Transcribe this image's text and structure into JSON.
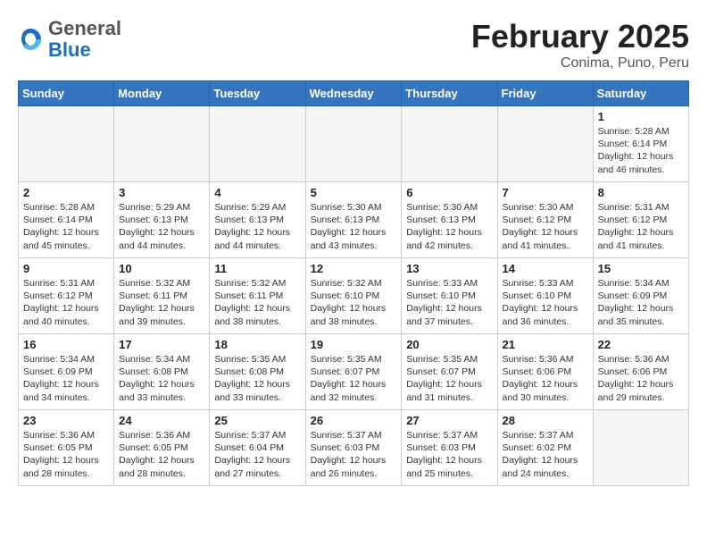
{
  "header": {
    "logo_general": "General",
    "logo_blue": "Blue",
    "title": "February 2025",
    "subtitle": "Conima, Puno, Peru"
  },
  "days_of_week": [
    "Sunday",
    "Monday",
    "Tuesday",
    "Wednesday",
    "Thursday",
    "Friday",
    "Saturday"
  ],
  "weeks": [
    [
      {
        "day": "",
        "info": ""
      },
      {
        "day": "",
        "info": ""
      },
      {
        "day": "",
        "info": ""
      },
      {
        "day": "",
        "info": ""
      },
      {
        "day": "",
        "info": ""
      },
      {
        "day": "",
        "info": ""
      },
      {
        "day": "1",
        "info": "Sunrise: 5:28 AM\nSunset: 6:14 PM\nDaylight: 12 hours\nand 46 minutes."
      }
    ],
    [
      {
        "day": "2",
        "info": "Sunrise: 5:28 AM\nSunset: 6:14 PM\nDaylight: 12 hours\nand 45 minutes."
      },
      {
        "day": "3",
        "info": "Sunrise: 5:29 AM\nSunset: 6:13 PM\nDaylight: 12 hours\nand 44 minutes."
      },
      {
        "day": "4",
        "info": "Sunrise: 5:29 AM\nSunset: 6:13 PM\nDaylight: 12 hours\nand 44 minutes."
      },
      {
        "day": "5",
        "info": "Sunrise: 5:30 AM\nSunset: 6:13 PM\nDaylight: 12 hours\nand 43 minutes."
      },
      {
        "day": "6",
        "info": "Sunrise: 5:30 AM\nSunset: 6:13 PM\nDaylight: 12 hours\nand 42 minutes."
      },
      {
        "day": "7",
        "info": "Sunrise: 5:30 AM\nSunset: 6:12 PM\nDaylight: 12 hours\nand 41 minutes."
      },
      {
        "day": "8",
        "info": "Sunrise: 5:31 AM\nSunset: 6:12 PM\nDaylight: 12 hours\nand 41 minutes."
      }
    ],
    [
      {
        "day": "9",
        "info": "Sunrise: 5:31 AM\nSunset: 6:12 PM\nDaylight: 12 hours\nand 40 minutes."
      },
      {
        "day": "10",
        "info": "Sunrise: 5:32 AM\nSunset: 6:11 PM\nDaylight: 12 hours\nand 39 minutes."
      },
      {
        "day": "11",
        "info": "Sunrise: 5:32 AM\nSunset: 6:11 PM\nDaylight: 12 hours\nand 38 minutes."
      },
      {
        "day": "12",
        "info": "Sunrise: 5:32 AM\nSunset: 6:10 PM\nDaylight: 12 hours\nand 38 minutes."
      },
      {
        "day": "13",
        "info": "Sunrise: 5:33 AM\nSunset: 6:10 PM\nDaylight: 12 hours\nand 37 minutes."
      },
      {
        "day": "14",
        "info": "Sunrise: 5:33 AM\nSunset: 6:10 PM\nDaylight: 12 hours\nand 36 minutes."
      },
      {
        "day": "15",
        "info": "Sunrise: 5:34 AM\nSunset: 6:09 PM\nDaylight: 12 hours\nand 35 minutes."
      }
    ],
    [
      {
        "day": "16",
        "info": "Sunrise: 5:34 AM\nSunset: 6:09 PM\nDaylight: 12 hours\nand 34 minutes."
      },
      {
        "day": "17",
        "info": "Sunrise: 5:34 AM\nSunset: 6:08 PM\nDaylight: 12 hours\nand 33 minutes."
      },
      {
        "day": "18",
        "info": "Sunrise: 5:35 AM\nSunset: 6:08 PM\nDaylight: 12 hours\nand 33 minutes."
      },
      {
        "day": "19",
        "info": "Sunrise: 5:35 AM\nSunset: 6:07 PM\nDaylight: 12 hours\nand 32 minutes."
      },
      {
        "day": "20",
        "info": "Sunrise: 5:35 AM\nSunset: 6:07 PM\nDaylight: 12 hours\nand 31 minutes."
      },
      {
        "day": "21",
        "info": "Sunrise: 5:36 AM\nSunset: 6:06 PM\nDaylight: 12 hours\nand 30 minutes."
      },
      {
        "day": "22",
        "info": "Sunrise: 5:36 AM\nSunset: 6:06 PM\nDaylight: 12 hours\nand 29 minutes."
      }
    ],
    [
      {
        "day": "23",
        "info": "Sunrise: 5:36 AM\nSunset: 6:05 PM\nDaylight: 12 hours\nand 28 minutes."
      },
      {
        "day": "24",
        "info": "Sunrise: 5:36 AM\nSunset: 6:05 PM\nDaylight: 12 hours\nand 28 minutes."
      },
      {
        "day": "25",
        "info": "Sunrise: 5:37 AM\nSunset: 6:04 PM\nDaylight: 12 hours\nand 27 minutes."
      },
      {
        "day": "26",
        "info": "Sunrise: 5:37 AM\nSunset: 6:03 PM\nDaylight: 12 hours\nand 26 minutes."
      },
      {
        "day": "27",
        "info": "Sunrise: 5:37 AM\nSunset: 6:03 PM\nDaylight: 12 hours\nand 25 minutes."
      },
      {
        "day": "28",
        "info": "Sunrise: 5:37 AM\nSunset: 6:02 PM\nDaylight: 12 hours\nand 24 minutes."
      },
      {
        "day": "",
        "info": ""
      }
    ]
  ]
}
